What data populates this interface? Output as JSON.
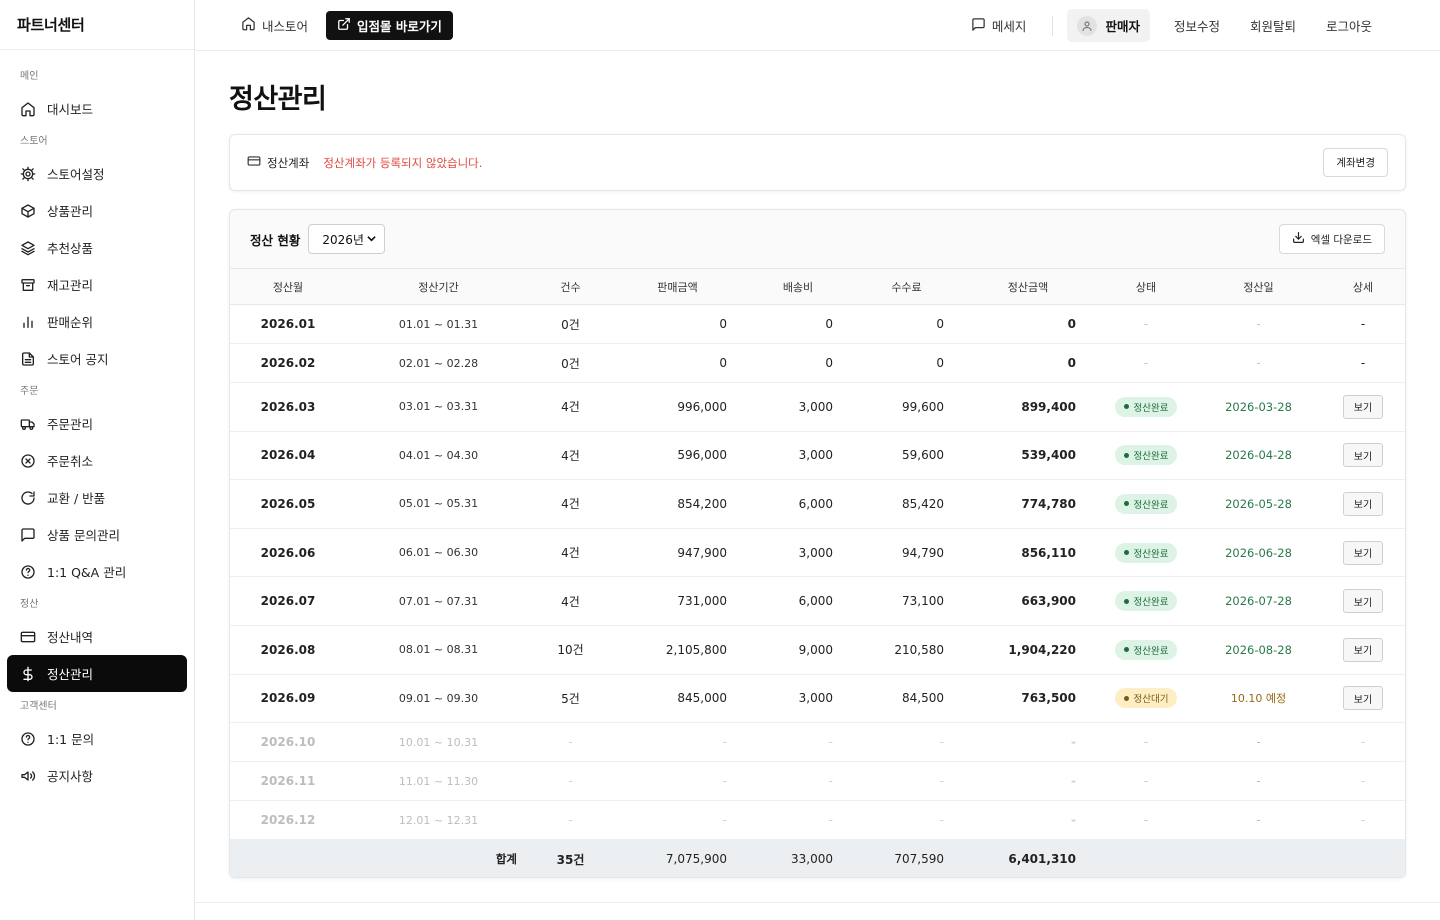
{
  "brand": "파트너센터",
  "topbar": {
    "home_label": "내스토어",
    "store_label": "입점몰 바로가기",
    "message_label": "메세지",
    "seller_label": "판매자",
    "edit_label": "정보수정",
    "withdraw_label": "회원탈퇴",
    "logout_label": "로그아웃"
  },
  "sidebar": {
    "sections": [
      {
        "title": "메인",
        "items": [
          {
            "label": "대시보드",
            "icon": "home-icon"
          }
        ]
      },
      {
        "title": "스토어",
        "items": [
          {
            "label": "스토어설정",
            "icon": "gear-icon"
          },
          {
            "label": "상품관리",
            "icon": "box-icon"
          },
          {
            "label": "추천상품",
            "icon": "layers-icon"
          },
          {
            "label": "재고관리",
            "icon": "archive-icon"
          },
          {
            "label": "판매순위",
            "icon": "bar-chart-icon"
          },
          {
            "label": "스토어 공지",
            "icon": "document-icon"
          }
        ]
      },
      {
        "title": "주문",
        "items": [
          {
            "label": "주문관리",
            "icon": "truck-icon"
          },
          {
            "label": "주문취소",
            "icon": "x-circle-icon"
          },
          {
            "label": "교환 / 반품",
            "icon": "refresh-icon"
          },
          {
            "label": "상품 문의관리",
            "icon": "chat-icon"
          },
          {
            "label": "1:1 Q&A 관리",
            "icon": "help-circle-icon"
          }
        ]
      },
      {
        "title": "정산",
        "items": [
          {
            "label": "정산내역",
            "icon": "card-icon"
          },
          {
            "label": "정산관리",
            "icon": "dollar-icon",
            "active": true
          }
        ]
      },
      {
        "title": "고객센터",
        "items": [
          {
            "label": "1:1 문의",
            "icon": "help-circle-icon"
          },
          {
            "label": "공지사항",
            "icon": "megaphone-icon"
          }
        ]
      }
    ]
  },
  "page": {
    "title": "정산관리",
    "account": {
      "label": "정산계좌",
      "warning": "정산계좌가 등록되지 않았습니다.",
      "button": "계좌변경"
    },
    "status": {
      "title": "정산 현황",
      "year": "2026년",
      "excel_button": "엑셀 다운로드"
    }
  },
  "table": {
    "headers": [
      "정산월",
      "정산기간",
      "건수",
      "판매금액",
      "배송비",
      "수수료",
      "정산금액",
      "상태",
      "정산일",
      "상세"
    ],
    "rows": [
      {
        "month": "2026.01",
        "period": "01.01 ~ 01.31",
        "count": "0건",
        "sales": "0",
        "shipping": "0",
        "fee": "0",
        "settle": "0",
        "status": "-",
        "status_type": "none",
        "date": "-",
        "date_type": "none",
        "detail": "-",
        "kind": "short"
      },
      {
        "month": "2026.02",
        "period": "02.01 ~ 02.28",
        "count": "0건",
        "sales": "0",
        "shipping": "0",
        "fee": "0",
        "settle": "0",
        "status": "-",
        "status_type": "none",
        "date": "-",
        "date_type": "none",
        "detail": "-",
        "kind": "short"
      },
      {
        "month": "2026.03",
        "period": "03.01 ~ 03.31",
        "count": "4건",
        "sales": "996,000",
        "shipping": "3,000",
        "fee": "99,600",
        "settle": "899,400",
        "status": "정산완료",
        "status_type": "done",
        "date": "2026-03-28",
        "date_type": "green",
        "detail": "보기",
        "kind": "tall"
      },
      {
        "month": "2026.04",
        "period": "04.01 ~ 04.30",
        "count": "4건",
        "sales": "596,000",
        "shipping": "3,000",
        "fee": "59,600",
        "settle": "539,400",
        "status": "정산완료",
        "status_type": "done",
        "date": "2026-04-28",
        "date_type": "green",
        "detail": "보기",
        "kind": "tall"
      },
      {
        "month": "2026.05",
        "period": "05.01 ~ 05.31",
        "count": "4건",
        "sales": "854,200",
        "shipping": "6,000",
        "fee": "85,420",
        "settle": "774,780",
        "status": "정산완료",
        "status_type": "done",
        "date": "2026-05-28",
        "date_type": "green",
        "detail": "보기",
        "kind": "tall"
      },
      {
        "month": "2026.06",
        "period": "06.01 ~ 06.30",
        "count": "4건",
        "sales": "947,900",
        "shipping": "3,000",
        "fee": "94,790",
        "settle": "856,110",
        "status": "정산완료",
        "status_type": "done",
        "date": "2026-06-28",
        "date_type": "green",
        "detail": "보기",
        "kind": "tall"
      },
      {
        "month": "2026.07",
        "period": "07.01 ~ 07.31",
        "count": "4건",
        "sales": "731,000",
        "shipping": "6,000",
        "fee": "73,100",
        "settle": "663,900",
        "status": "정산완료",
        "status_type": "done",
        "date": "2026-07-28",
        "date_type": "green",
        "detail": "보기",
        "kind": "tall"
      },
      {
        "month": "2026.08",
        "period": "08.01 ~ 08.31",
        "count": "10건",
        "sales": "2,105,800",
        "shipping": "9,000",
        "fee": "210,580",
        "settle": "1,904,220",
        "status": "정산완료",
        "status_type": "done",
        "date": "2026-08-28",
        "date_type": "green",
        "detail": "보기",
        "kind": "tall"
      },
      {
        "month": "2026.09",
        "period": "09.01 ~ 09.30",
        "count": "5건",
        "sales": "845,000",
        "shipping": "3,000",
        "fee": "84,500",
        "settle": "763,500",
        "status": "정산대기",
        "status_type": "wait",
        "date": "10.10 예정",
        "date_type": "amber",
        "detail": "보기",
        "kind": "tall"
      },
      {
        "month": "2026.10",
        "period": "10.01 ~ 10.31",
        "count": "-",
        "sales": "-",
        "shipping": "-",
        "fee": "-",
        "settle": "-",
        "status": "-",
        "status_type": "none",
        "date": "-",
        "date_type": "none",
        "detail": "-",
        "kind": "dim"
      },
      {
        "month": "2026.11",
        "period": "11.01 ~ 11.30",
        "count": "-",
        "sales": "-",
        "shipping": "-",
        "fee": "-",
        "settle": "-",
        "status": "-",
        "status_type": "none",
        "date": "-",
        "date_type": "none",
        "detail": "-",
        "kind": "dim"
      },
      {
        "month": "2026.12",
        "period": "12.01 ~ 12.31",
        "count": "-",
        "sales": "-",
        "shipping": "-",
        "fee": "-",
        "settle": "-",
        "status": "-",
        "status_type": "none",
        "date": "-",
        "date_type": "none",
        "detail": "-",
        "kind": "dim"
      }
    ],
    "footer": {
      "label": "합계",
      "count": "35건",
      "sales": "7,075,900",
      "shipping": "33,000",
      "fee": "707,590",
      "settle": "6,401,310"
    }
  }
}
